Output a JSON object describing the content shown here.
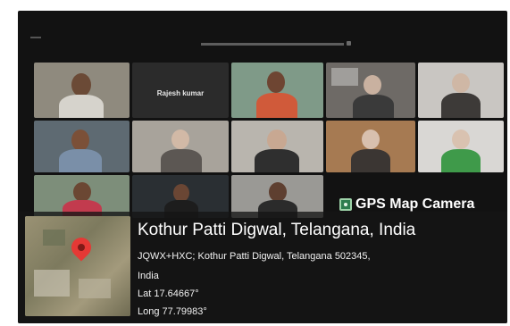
{
  "meeting": {
    "name_label": "Rajesh kumar"
  },
  "watermark": {
    "brand": "GPS Map Camera",
    "location_title": "Kothur Patti Digwal, Telangana, India",
    "address_line1": "JQWX+HXC; Kothur Patti Digwal, Telangana 502345,",
    "address_line2": "India",
    "latitude": "Lat 17.64667°",
    "longitude": "Long 77.79983°"
  },
  "colors": {
    "pin": "#e53935",
    "background": "#121212"
  }
}
